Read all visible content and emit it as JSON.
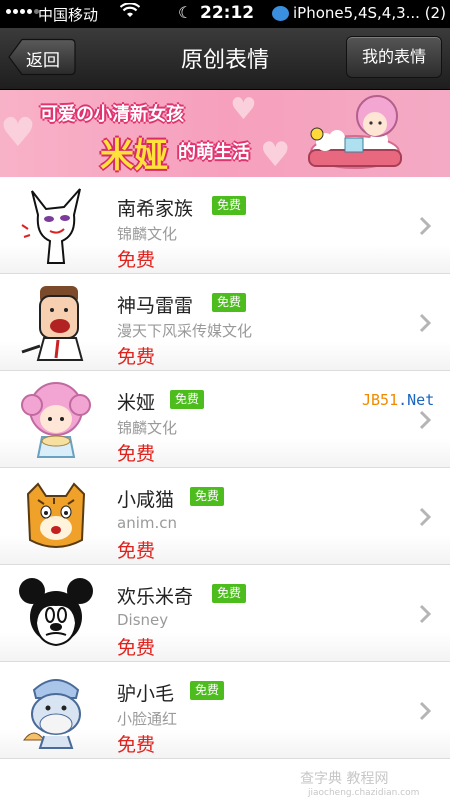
{
  "status_bar": {
    "carrier": "中国移动",
    "time": "22:12",
    "notification": "iPhone5,4S,4,3... (2)"
  },
  "nav": {
    "back_label": "返回",
    "title": "原创表情",
    "my_label": "我的表情"
  },
  "banner": {
    "line1": "可爱の小清新女孩",
    "big": "米娅",
    "small": "的萌生活"
  },
  "items": [
    {
      "name": "南希家族",
      "badge": "免费",
      "author": "锦麟文化",
      "price": "免费",
      "icon": "fox-girl-icon"
    },
    {
      "name": "神马雷雷",
      "badge": "免费",
      "author": "漫天下风采传媒文化",
      "price": "免费",
      "icon": "leilei-man-icon"
    },
    {
      "name": "米娅",
      "badge": "免费",
      "author": "锦麟文化",
      "price": "免费",
      "icon": "mia-girl-icon"
    },
    {
      "name": "小咸猫",
      "badge": "免费",
      "author": "anim.cn",
      "price": "免费",
      "icon": "tiger-cat-icon"
    },
    {
      "name": "欢乐米奇",
      "badge": "免费",
      "author": "Disney",
      "price": "免费",
      "icon": "mickey-icon"
    },
    {
      "name": "驴小毛",
      "badge": "免费",
      "author": "小脸通红",
      "price": "免费",
      "icon": "donkey-icon"
    }
  ],
  "watermark": {
    "part1": "JB51",
    "part2": ".Net"
  },
  "bottom_watermark": {
    "main": "查字典 教程网",
    "sub": "jiaocheng.chazidian.com"
  },
  "colors": {
    "accent_green": "#4dbd1e",
    "price_red": "#e0221d",
    "banner_pink": "#f6a0bd"
  }
}
